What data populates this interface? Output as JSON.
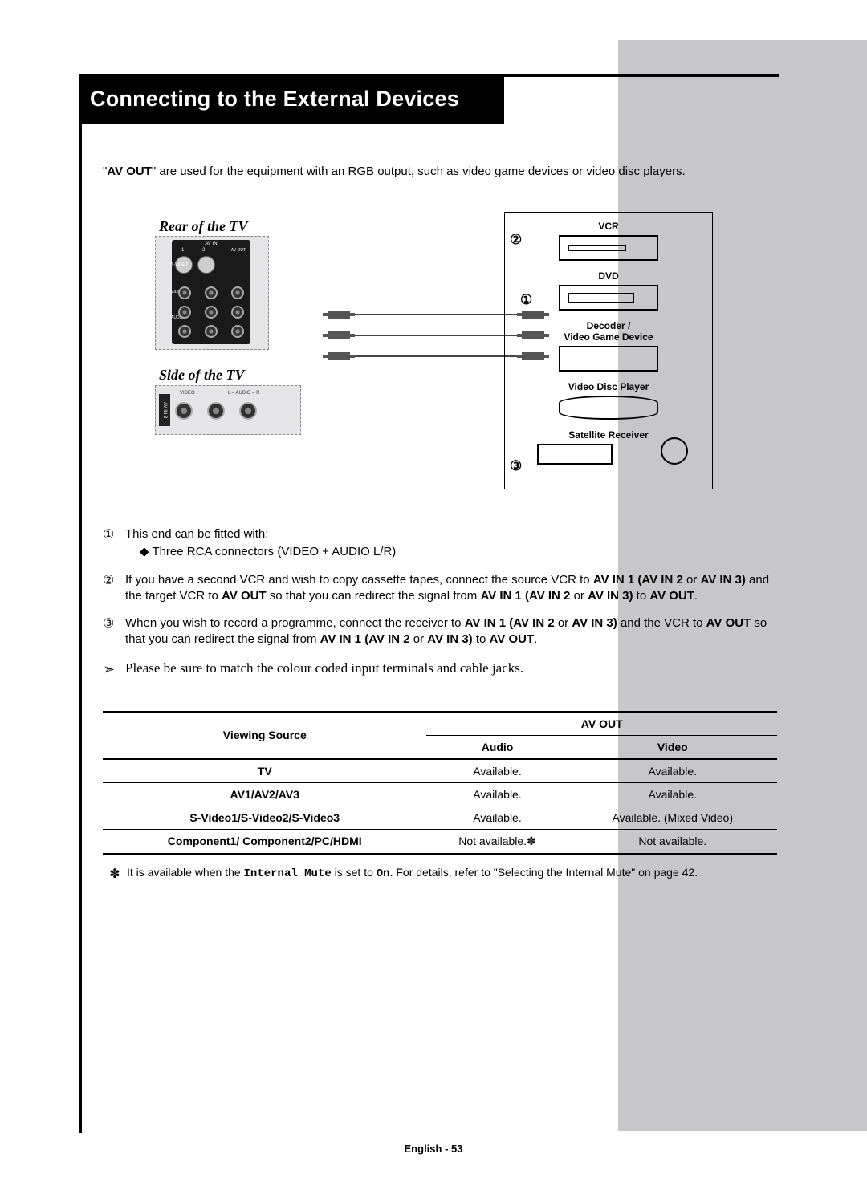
{
  "title": "Connecting to the External Devices",
  "intro_pre": "\"",
  "intro_bold": "AV OUT",
  "intro_post": "\" are used for the equipment with an RGB output, such as video game devices or video disc players.",
  "caption_rear": "Rear of the TV",
  "caption_side": "Side of the TV",
  "panel": {
    "avin": "AV IN",
    "one": "1",
    "two": "2",
    "avout": "AV OUT",
    "svideo": "S-VIDEO",
    "video": "VIDEO",
    "audio": "AUDIO",
    "L": "L",
    "R": "R",
    "av_in3": "AV IN 3",
    "side_video": "VIDEO",
    "side_audio": "L – AUDIO – R"
  },
  "marker1": "①",
  "marker2": "②",
  "marker3": "③",
  "devices": {
    "vcr": "VCR",
    "dvd": "DVD",
    "decoder": "Decoder /\nVideo Game Device",
    "disc": "Video Disc Player",
    "sat": "Satellite Receiver"
  },
  "notes": {
    "n1a": "This end can be fitted with:",
    "n1b": "◆   Three RCA connectors (VIDEO + AUDIO L/R)",
    "n2": "If you have a second VCR and wish to copy cassette tapes, connect the source VCR to AV IN 1 (AV IN 2 or AV IN 3) and the target VCR to AV OUT so that you can redirect the signal from AV IN 1 (AV IN 2 or AV IN 3) to AV OUT.",
    "n3": "When you wish to record a programme, connect the receiver to AV IN 1 (AV IN 2 or AV IN 3) and the VCR to AV OUT so that you can redirect the signal from AV IN 1 (AV IN 2 or AV IN 3) to AV OUT."
  },
  "hint_icon": "➣",
  "hint": "Please be sure to match the colour coded input terminals and cable jacks.",
  "table": {
    "head_source": "Viewing Source",
    "head_avout": "AV OUT",
    "head_audio": "Audio",
    "head_video": "Video",
    "rows": [
      {
        "s": "TV",
        "a": "Available.",
        "v": "Available."
      },
      {
        "s": "AV1/AV2/AV3",
        "a": "Available.",
        "v": "Available."
      },
      {
        "s": "S-Video1/S-Video2/S-Video3",
        "a": "Available.",
        "v": "Available. (Mixed Video)"
      },
      {
        "s": "Component1/ Component2/PC/HDMI",
        "a": "Not available.✽",
        "v": "Not available."
      }
    ]
  },
  "footnote_star": "✽",
  "footnote_pre": "It is available when the ",
  "footnote_mono": "Internal Mute",
  "footnote_mid": " is set to ",
  "footnote_mono2": "On",
  "footnote_post": ". For details, refer to \"Selecting the Internal Mute\" on page 42.",
  "page_number": "English - 53"
}
